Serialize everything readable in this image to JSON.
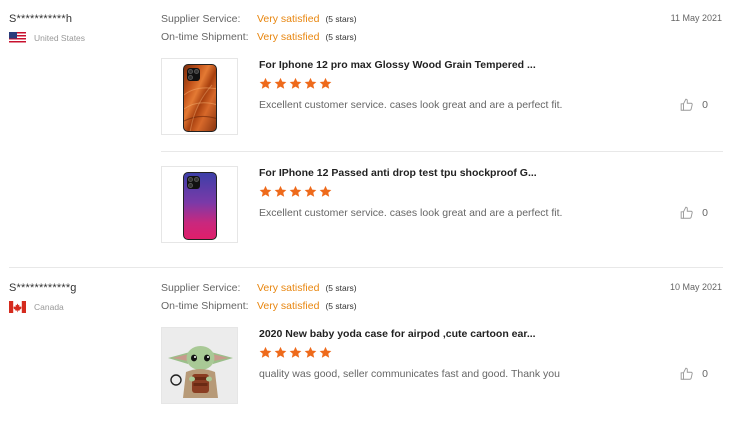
{
  "reviews": [
    {
      "buyer": "S***********h",
      "country": "United States",
      "date": "11 May 2021",
      "supplier_label": "Supplier Service:",
      "supplier_value": "Very satisfied",
      "supplier_stars": "(5 stars)",
      "shipment_label": "On-time Shipment:",
      "shipment_value": "Very satisfied",
      "shipment_stars": "(5 stars)",
      "items": [
        {
          "title": "For Iphone 12 pro max Glossy Wood Grain Tempered ...",
          "rating": 5,
          "comment": "Excellent customer service. cases look great and are a perfect fit.",
          "likes": "0"
        },
        {
          "title": "For IPhone 12 Passed anti drop test tpu shockproof G...",
          "rating": 5,
          "comment": "Excellent customer service. cases look great and are a perfect fit.",
          "likes": "0"
        }
      ]
    },
    {
      "buyer": "S************g",
      "country": "Canada",
      "date": "10 May 2021",
      "supplier_label": "Supplier Service:",
      "supplier_value": "Very satisfied",
      "supplier_stars": "(5 stars)",
      "shipment_label": "On-time Shipment:",
      "shipment_value": "Very satisfied",
      "shipment_stars": "(5 stars)",
      "items": [
        {
          "title": "2020 New baby yoda case for airpod ,cute cartoon ear...",
          "rating": 5,
          "comment": "quality was good, seller communicates fast and good. Thank you",
          "likes": "0"
        }
      ]
    }
  ],
  "colors": {
    "rating_accent": "#e8860f",
    "star": "#ee6a1b"
  },
  "icons": {
    "star": "star-icon",
    "like": "thumbs-up-icon",
    "flag_us": "flag-us-icon",
    "flag_ca": "flag-ca-icon"
  }
}
